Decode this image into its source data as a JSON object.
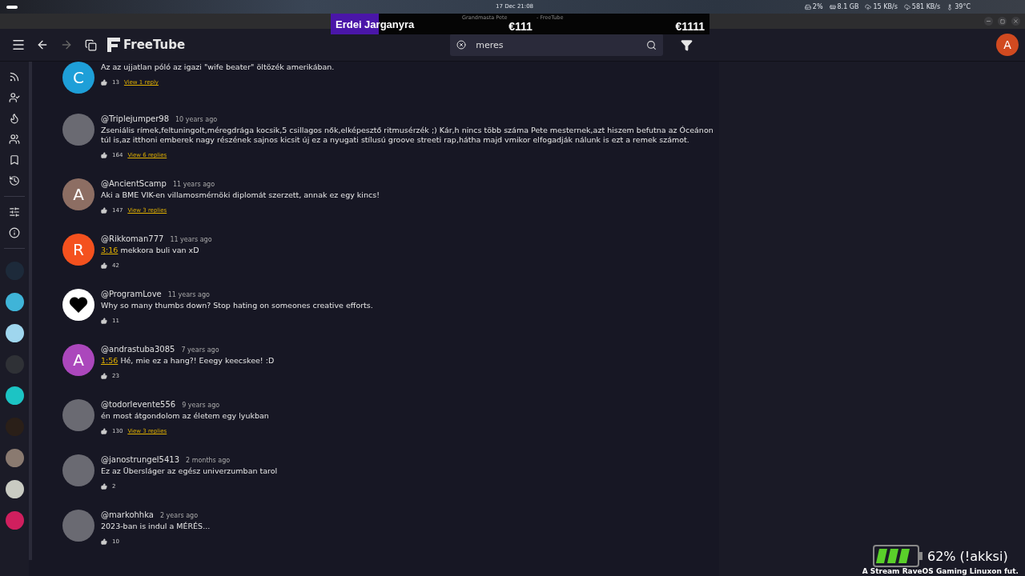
{
  "system_bar": {
    "clock": "17 Dec 21:08",
    "tray": [
      {
        "kind": "disk",
        "text": "2%"
      },
      {
        "kind": "memory",
        "text": "8.1 GB"
      },
      {
        "kind": "upload",
        "text": "15 KB/s"
      },
      {
        "kind": "download",
        "text": "581 KB/s"
      },
      {
        "kind": "temperature",
        "text": "39°C"
      }
    ]
  },
  "window": {
    "title_start": "Grandmasta Pete",
    "title_end": "- FreeTube"
  },
  "stream_overlay": {
    "song": "Erdei Jarganyra",
    "amount_1": "€111",
    "amount_2": "€1111"
  },
  "header": {
    "logo": "FreeTube",
    "forward_disabled": true,
    "search": {
      "value": "meres"
    },
    "avatar": "A"
  },
  "sidebar": {
    "items": [
      {
        "kind": "subscriptions"
      },
      {
        "kind": "channels"
      },
      {
        "kind": "trending"
      },
      {
        "kind": "popular"
      },
      {
        "kind": "saved"
      },
      {
        "kind": "history"
      },
      {
        "kind": "divider"
      },
      {
        "kind": "settings"
      },
      {
        "kind": "about"
      },
      {
        "kind": "divider"
      }
    ],
    "channels": [
      {
        "color": "#1d2a3a"
      },
      {
        "color": "#3fb4d8"
      },
      {
        "color": "#9fd6ee"
      },
      {
        "color": "#2f3136"
      },
      {
        "color": "#1cc4c4"
      },
      {
        "color": "#2a1f18"
      },
      {
        "color": "#8a7a70"
      },
      {
        "color": "#c9cbc2"
      },
      {
        "color": "#d01f5e"
      }
    ]
  },
  "comments": [
    {
      "avatar": {
        "kind": "letter",
        "letter": "C",
        "color": "#1e9fd8"
      },
      "body": "Az az ujjatlan póló az igazi \"wife beater\" öltözék amerikában.",
      "likes": "13",
      "replies": "View 1 reply"
    },
    {
      "avatar": {
        "kind": "photo"
      },
      "author": "@Triplejumper98",
      "time": "10 years ago",
      "body": "Zseniális rímek,feltuningolt,méregdrága kocsik,5 csillagos nők,elképesztő ritmusérzék ;) Kár,h nincs több száma Pete mesternek,azt hiszem befutna az Óceánon túl is,az itthoni emberek nagy részének sajnos kicsit új ez a nyugati stílusú groove streeti rap,hátha majd vmikor elfogadják nálunk is ezt a remek számot.",
      "likes": "164",
      "replies": "View 6 replies"
    },
    {
      "avatar": {
        "kind": "letter",
        "letter": "A",
        "color": "#8d6e63"
      },
      "author": "@AncientScamp",
      "time": "11 years ago",
      "body": "Aki a BME VIK-en villamosmérnöki diplomát szerzett, annak ez egy kincs!",
      "likes": "147",
      "replies": "View 3 replies"
    },
    {
      "avatar": {
        "kind": "letter",
        "letter": "R",
        "color": "#f4511e"
      },
      "author": "@Rikkoman777",
      "time": "11 years ago",
      "timestamp": "3:16",
      "body": "mekkora buli van xD",
      "likes": "42"
    },
    {
      "avatar": {
        "kind": "heart"
      },
      "author": "@ProgramLove",
      "time": "11 years ago",
      "body": "Why so many thumbs down? Stop hating on someones creative efforts.",
      "likes": "11"
    },
    {
      "avatar": {
        "kind": "letter",
        "letter": "A",
        "color": "#ab47bc"
      },
      "author": "@andrastuba3085",
      "time": "7 years ago",
      "timestamp": "1:56",
      "body": "Hé, mie ez a hang?! Eeegy keecskee! :D",
      "likes": "23"
    },
    {
      "avatar": {
        "kind": "photo"
      },
      "author": "@todorlevente556",
      "time": "9 years ago",
      "body": "én most átgondolom az életem egy lyukban",
      "likes": "130",
      "replies": "View 3 replies"
    },
    {
      "avatar": {
        "kind": "photo"
      },
      "author": "@janostrungel5413",
      "time": "2 months ago",
      "body": "Ez az Übersláger az egész univerzumban tarol",
      "likes": "2"
    },
    {
      "avatar": {
        "kind": "photo"
      },
      "author": "@markohhka",
      "time": "2 years ago",
      "body": "2023-ban is indul a MÉRÉS...",
      "likes": "10"
    }
  ],
  "battery_overlay": {
    "reading": "62% (!akksi)",
    "caption": "A Stream RaveOS Gaming Linuxon fut."
  }
}
